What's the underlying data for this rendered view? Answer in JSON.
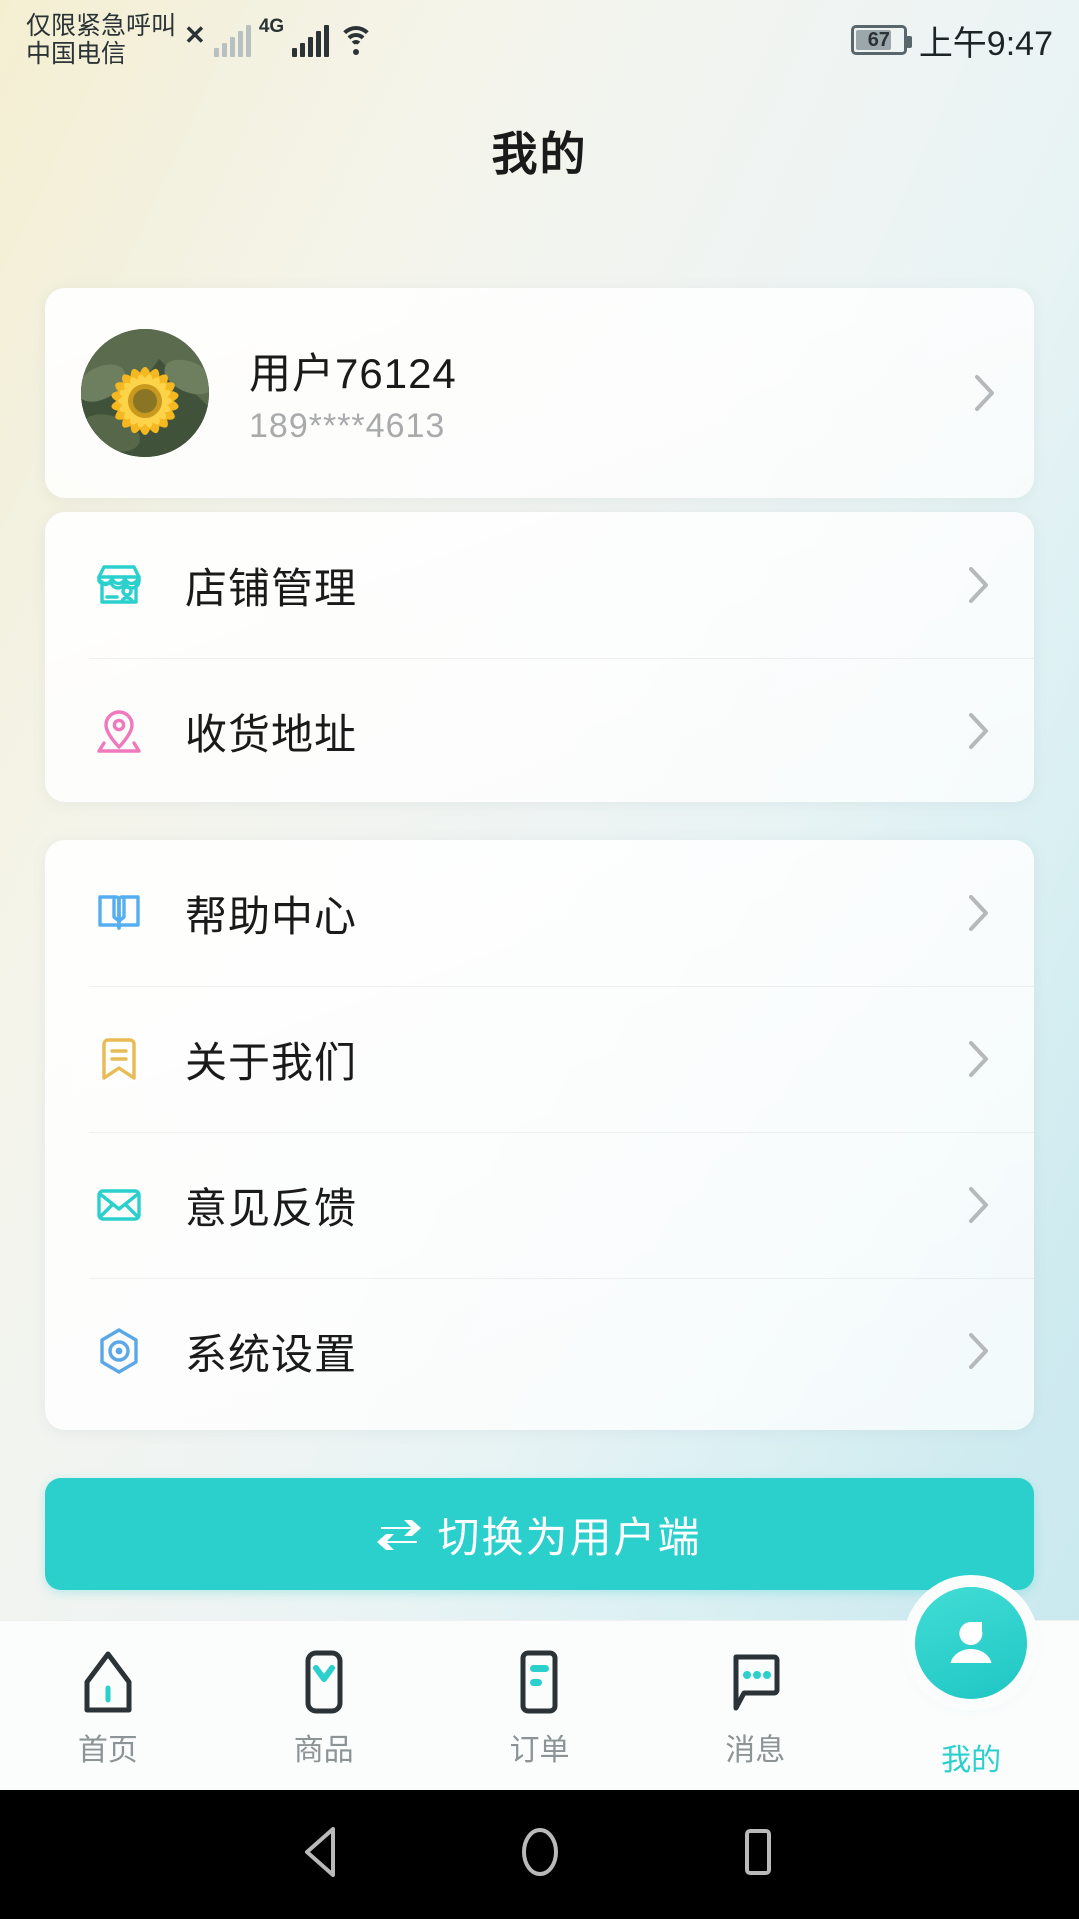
{
  "status_bar": {
    "carrier_line1": "仅限紧急呼叫",
    "carrier_line2": "中国电信",
    "sim_x": "✕",
    "network_type": "4G",
    "battery_percent": "67",
    "time": "上午9:47"
  },
  "header": {
    "title": "我的"
  },
  "profile": {
    "name": "用户76124",
    "phone": "189****4613",
    "avatar_icon": "sunflower-photo",
    "chevron_icon": "chevron-right-icon"
  },
  "menu_group_1": {
    "items": [
      {
        "label": "店铺管理",
        "icon": "storefront-icon",
        "color": "#2bd0cd"
      },
      {
        "label": "收货地址",
        "icon": "location-pin-icon",
        "color": "#f078bd"
      }
    ]
  },
  "menu_group_2": {
    "items": [
      {
        "label": "帮助中心",
        "icon": "open-book-icon",
        "color": "#55aef0"
      },
      {
        "label": "关于我们",
        "icon": "bookmark-icon",
        "color": "#e8bb55"
      },
      {
        "label": "意见反馈",
        "icon": "envelope-icon",
        "color": "#2bd0cd"
      },
      {
        "label": "系统设置",
        "icon": "hexagon-gear-icon",
        "color": "#5aa8e8"
      }
    ]
  },
  "switch_button": {
    "label": "切换为用户端",
    "icon": "swap-arrows-icon",
    "color": "#2bd0cd"
  },
  "bottom_nav": {
    "items": [
      {
        "label": "首页",
        "icon": "home-icon",
        "active": false
      },
      {
        "label": "商品",
        "icon": "product-icon",
        "active": false
      },
      {
        "label": "订单",
        "icon": "order-list-icon",
        "active": false
      },
      {
        "label": "消息",
        "icon": "message-bubble-icon",
        "active": false
      },
      {
        "label": "我的",
        "icon": "person-icon",
        "active": true
      }
    ],
    "active_color": "#2bd0cd",
    "inactive_color": "#8d9496"
  },
  "android_nav": {
    "back": "back-triangle-icon",
    "home": "home-circle-icon",
    "recents": "recents-square-icon"
  }
}
